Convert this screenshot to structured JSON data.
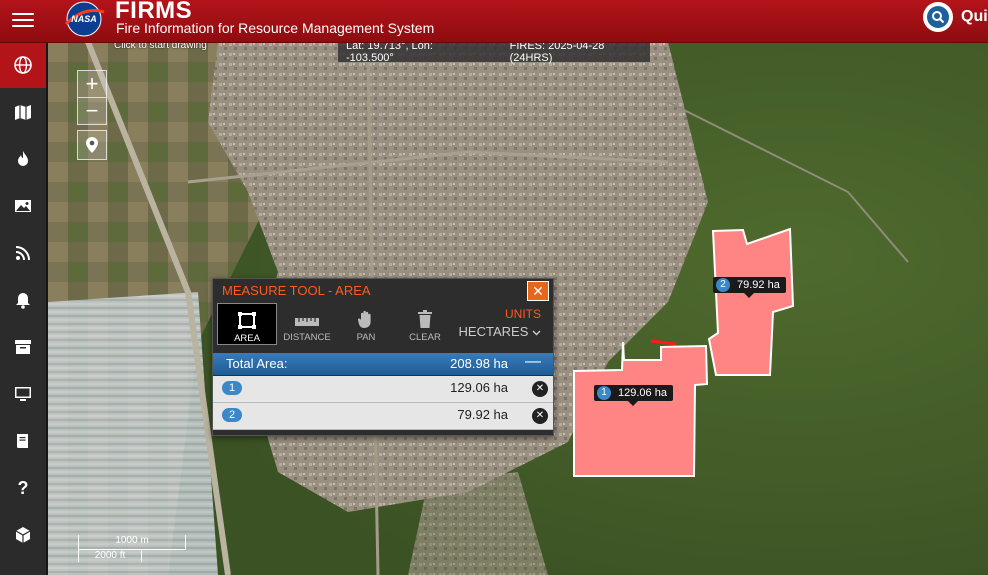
{
  "header": {
    "logo_text": "NASA",
    "title": "FIRMS",
    "subtitle": "Fire Information for Resource Management System",
    "quick_label": "Qui"
  },
  "sidebar": {
    "items": [
      {
        "name": "globe",
        "active": true
      },
      {
        "name": "map",
        "active": false
      },
      {
        "name": "fire",
        "active": false
      },
      {
        "name": "image",
        "active": false
      },
      {
        "name": "rss",
        "active": false
      },
      {
        "name": "bell",
        "active": false
      },
      {
        "name": "archive",
        "active": false
      },
      {
        "name": "desktop",
        "active": false
      },
      {
        "name": "book",
        "active": false
      },
      {
        "name": "help",
        "glyph": "?",
        "active": false
      },
      {
        "name": "box",
        "active": false
      }
    ]
  },
  "map": {
    "hint": "Click to start drawing",
    "status_coords": "Lat: 19.713°, Lon: -103.500°",
    "status_fires": "FIRES: 2025-04-28 (24HRS)",
    "zoom_in": "+",
    "zoom_out": "−",
    "scale_metric": "1000 m",
    "scale_imperial": "2000 ft",
    "polygons": [
      {
        "id": "1",
        "area_label": "129.06 ha"
      },
      {
        "id": "2",
        "area_label": "79.92 ha"
      }
    ]
  },
  "measure": {
    "title": "MEASURE TOOL - AREA",
    "close": "✕",
    "tools": [
      "AREA",
      "DISTANCE",
      "PAN",
      "CLEAR"
    ],
    "units_label": "UNITS",
    "units_value": "HECTARES",
    "total_label": "Total Area:",
    "total_value": "208.98 ha",
    "rows": [
      {
        "id": "1",
        "value": "129.06 ha"
      },
      {
        "id": "2",
        "value": "79.92 ha"
      }
    ]
  }
}
